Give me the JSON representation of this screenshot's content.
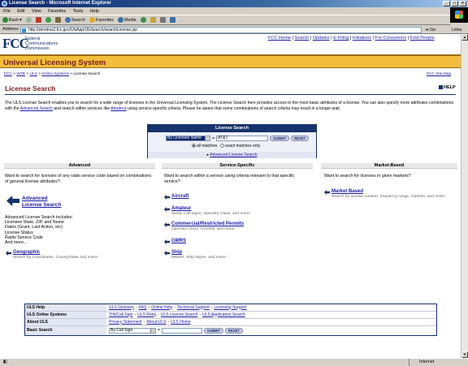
{
  "window": {
    "title": "License Search - Microsoft Internet Explorer"
  },
  "menu": [
    "File",
    "Edit",
    "View",
    "Favorites",
    "Tools",
    "Help"
  ],
  "toolbar": {
    "back": "Back",
    "search": "Search",
    "favorites": "Favorites",
    "media": "Media"
  },
  "address": {
    "label": "Address",
    "url": "http://wireless2.fcc.gov/UlsApp/UlsSearch/searchLicense.jsp",
    "go": "Go",
    "links": "Links"
  },
  "fcc": {
    "logo": "FCC",
    "line1": "Federal",
    "line2": "Communications",
    "line3": "Commission"
  },
  "topnav": [
    "FCC Home",
    "Search",
    "Updates",
    "E-Filing",
    "Initiatives",
    "For Consumers",
    "Find People"
  ],
  "band_title": "Universal Licensing System",
  "breadcrumb": {
    "items": [
      "FCC",
      "WTB",
      "ULS",
      "Online Systems"
    ],
    "current": "License Search",
    "sitemap": "FCC Site Map"
  },
  "heading": "License Search",
  "help": "HELP",
  "intro": {
    "p1": "The ULS License Search enables you to search for a wide range of licenses in the Universal Licensing System. The License Search here provides access to the most basic attributes of a license. You can also specify more attributes combinations with the ",
    "link1": "Advanced Search",
    "p2": " and search within services like ",
    "link2": "Amateur",
    "p3": " using service-specific criteria. Please be aware that some combinations of search criteria may result in a longer wait."
  },
  "search_box": {
    "title": "License Search",
    "field": "By Licensee Name",
    "equals": "=",
    "value": "AT&T",
    "submit": "SUBMIT",
    "reset": "RESET",
    "opt_all": "all matches",
    "opt_exact": "exact matches only",
    "advanced_link": "Advanced License Search"
  },
  "advanced": {
    "header": "Advanced",
    "question": "Want to search for licenses of any radio service code based on combinations of general license attributes?",
    "link": "Advanced License Search",
    "link_l1": "Advanced",
    "link_l2": "License Search",
    "includes_title": "Advanced License Search includes:",
    "includes": [
      "Licensee State, ZIP, and Name",
      "Dates (Grant, Last Action, etc)",
      "License Status",
      "Radio Service Code",
      "And more..."
    ],
    "geo_link": "Geographic",
    "geo_desc": "Search by Coordinates, County/State and more!"
  },
  "service": {
    "header": "Service-Specific",
    "question": "Want to search within a service using criteria relevant to that specific service?",
    "items": [
      {
        "label": "Aircraft",
        "desc": ""
      },
      {
        "label": "Amateur",
        "desc": "Vanity Call Signs, Operator Class, and more!"
      },
      {
        "label": "Commercial/Restricted Permits",
        "desc": "Operator Class, COLEM, and more!"
      },
      {
        "label": "GMRS",
        "desc": ""
      },
      {
        "label": "Ship",
        "desc": "MMSI#, Ship Name, and more!"
      }
    ]
  },
  "market": {
    "header": "Market-Based",
    "question": "Want to search for licenses in given markets?",
    "link": "Market Based",
    "desc": "Search by auction number, frequency range, markets, and more!"
  },
  "bottom": {
    "uls_help": {
      "label": "ULS Help",
      "links": [
        "ULS Glossary",
        "FAQ",
        "Online Help",
        "Technical Support",
        "Licensing Support"
      ]
    },
    "uls_online": {
      "label": "ULS Online Systems",
      "links": [
        "TIN/Call Sign",
        "ULS Filing",
        "ULS License Search",
        "ULS Application Search"
      ]
    },
    "about": {
      "label": "About ULS",
      "links": [
        "Privacy Statement",
        "About ULS",
        "ULS Home"
      ]
    },
    "basic": {
      "label": "Basic Search",
      "field": "By Call Sign",
      "equals": "=",
      "submit": "SUBMIT",
      "reset": "RESET"
    }
  },
  "status": {
    "zone": "Internet"
  }
}
